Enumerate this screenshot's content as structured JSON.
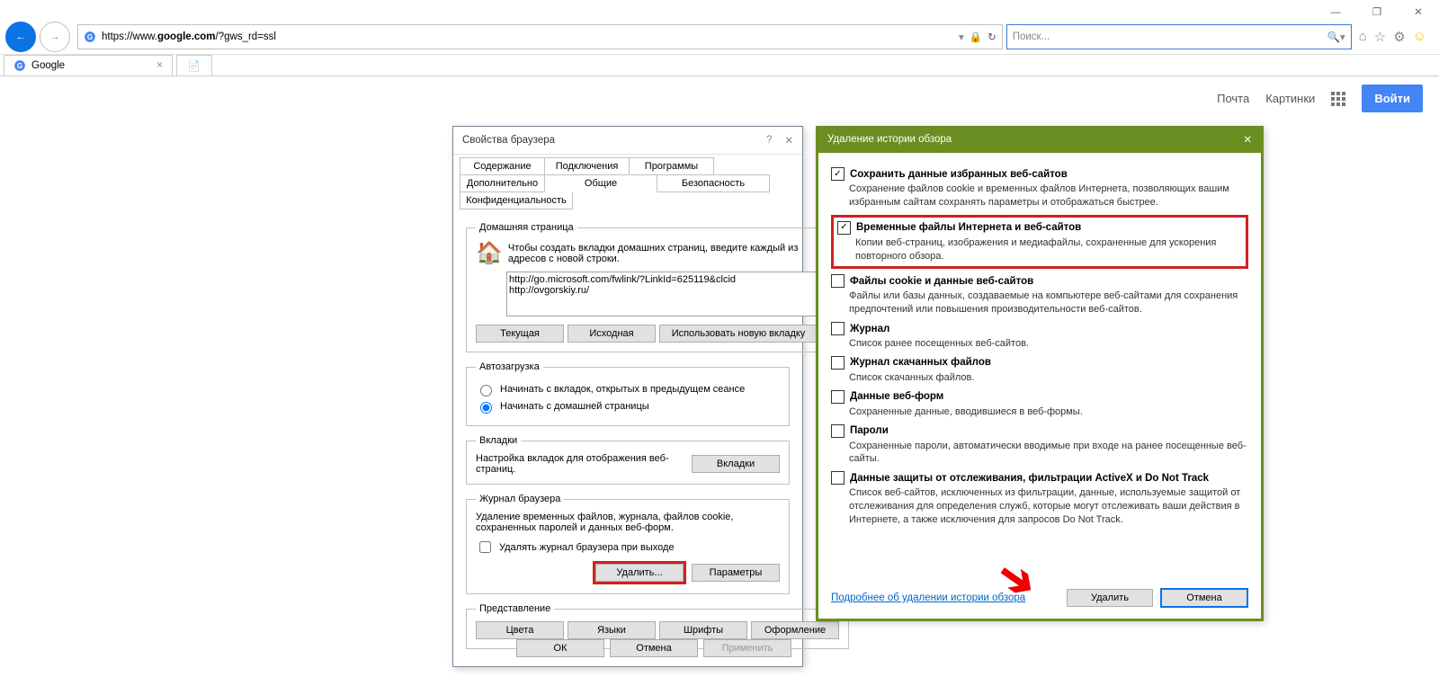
{
  "window": {
    "min": "—",
    "max": "❐",
    "close": "✕"
  },
  "toolbar": {
    "url_prefix": "https://www.",
    "url_host": "google.com",
    "url_suffix": "/?gws_rd=ssl",
    "search_placeholder": "Поиск..."
  },
  "tab": {
    "title": "Google",
    "close": "×"
  },
  "google": {
    "mail": "Почта",
    "images": "Картинки",
    "signin": "Войти"
  },
  "props": {
    "title": "Свойства браузера",
    "help": "?",
    "close": "✕",
    "tabs_row1": [
      "Содержание",
      "Подключения",
      "Программы",
      "Дополнительно"
    ],
    "tabs_row2": [
      "Общие",
      "Безопасность",
      "Конфиденциальность"
    ],
    "active_tab": "Общие",
    "home": {
      "legend": "Домашняя страница",
      "hint": "Чтобы создать вкладки домашних страниц, введите каждый из адресов с новой строки.",
      "value": "http://go.microsoft.com/fwlink/?LinkId=625119&clcid\nhttp://ovgorskiy.ru/",
      "btn_current": "Текущая",
      "btn_default": "Исходная",
      "btn_newtab": "Использовать новую вкладку"
    },
    "startup": {
      "legend": "Автозагрузка",
      "opt1": "Начинать с вкладок, открытых в предыдущем сеансе",
      "opt2": "Начинать с домашней страницы"
    },
    "tabsg": {
      "legend": "Вкладки",
      "hint": "Настройка вкладок для отображения веб-страниц.",
      "btn": "Вкладки"
    },
    "history": {
      "legend": "Журнал браузера",
      "hint": "Удаление временных файлов, журнала, файлов cookie, сохраненных паролей и данных веб-форм.",
      "chk": "Удалять журнал браузера при выходе",
      "btn_delete": "Удалить...",
      "btn_params": "Параметры"
    },
    "appearance": {
      "legend": "Представление",
      "colors": "Цвета",
      "langs": "Языки",
      "fonts": "Шрифты",
      "style": "Оформление"
    },
    "ok": "ОК",
    "cancel": "Отмена",
    "apply": "Применить"
  },
  "del": {
    "title": "Удаление истории обзора",
    "close": "✕",
    "items": [
      {
        "checked": true,
        "title": "Сохранить данные избранных веб-сайтов",
        "desc": "Сохранение файлов cookie и временных файлов Интернета, позволяющих вашим избранным сайтам сохранять параметры и отображаться быстрее."
      },
      {
        "checked": true,
        "title": "Временные файлы Интернета и веб-сайтов",
        "desc": "Копии веб-страниц, изображения и медиафайлы, сохраненные для ускорения повторного обзора.",
        "highlight": true
      },
      {
        "checked": false,
        "title": "Файлы cookie и данные веб-сайтов",
        "desc": "Файлы или базы данных, создаваемые на компьютере веб-сайтами для сохранения предпочтений или повышения производительности веб-сайтов."
      },
      {
        "checked": false,
        "title": "Журнал",
        "desc": "Список ранее посещенных веб-сайтов."
      },
      {
        "checked": false,
        "title": "Журнал скачанных файлов",
        "desc": "Список скачанных файлов."
      },
      {
        "checked": false,
        "title": "Данные веб-форм",
        "desc": "Сохраненные данные, вводившиеся в веб-формы."
      },
      {
        "checked": false,
        "title": "Пароли",
        "desc": "Сохраненные пароли, автоматически вводимые при входе на ранее посещенные веб-сайты."
      },
      {
        "checked": false,
        "title": "Данные защиты от отслеживания, фильтрации ActiveX и Do Not Track",
        "desc": "Список веб-сайтов, исключенных из фильтрации, данные, используемые защитой от отслеживания для определения служб, которые могут отслеживать ваши действия в Интернете, а также исключения для запросов Do Not Track."
      }
    ],
    "more": "Подробнее об удалении истории обзора",
    "delete": "Удалить",
    "cancel": "Отмена"
  }
}
